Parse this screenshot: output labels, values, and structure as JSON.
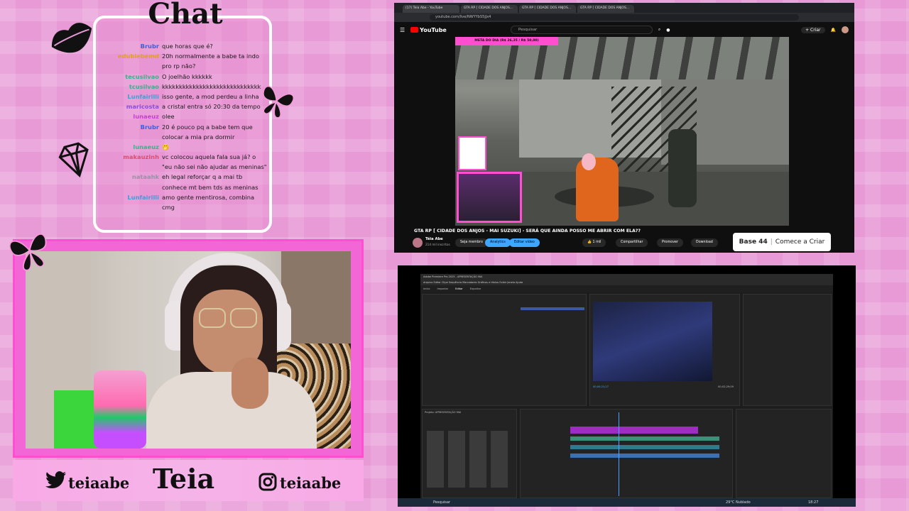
{
  "chat": {
    "title": "Chat",
    "messages": [
      {
        "user": "Brubr",
        "color": "#3f5fd8",
        "text": "que horas que é?"
      },
      {
        "user": "edubiebemd",
        "color": "#e2a11a",
        "text": "20h normalmente a babe ta indo"
      },
      {
        "user": "",
        "color": "#e2a11a",
        "text": "pro rp não?"
      },
      {
        "user": "tecusilvao",
        "color": "#37b38a",
        "text": "O joelhão kkkkkk"
      },
      {
        "user": "tcusilvao",
        "color": "#37b38a",
        "text": "kkkkkkkkkkkkkkkkkkkkkkkkkkkkk"
      },
      {
        "user": "Lunfairilli",
        "color": "#3f9fd8",
        "text": "isso gente, a mod perdeu a linha"
      },
      {
        "user": "maricosta",
        "color": "#8b4fd8",
        "text": "a cristal entra só 20:30 da tempo"
      },
      {
        "user": "lunaeuz",
        "color": "#c43fd0",
        "text": "olee"
      },
      {
        "user": "Brubr",
        "color": "#3f5fd8",
        "text": "20 é pouco pq a babe tem que"
      },
      {
        "user": "",
        "color": "#3f5fd8",
        "text": "colocar a mia pra dormir"
      },
      {
        "user": "lunaeuz",
        "color": "#37b38a",
        "text": "🤭"
      },
      {
        "user": "makauzinh",
        "color": "#d84f6f",
        "text": "vc colocou aquela fala sua já? o"
      },
      {
        "user": "",
        "color": "#d84f6f",
        "text": "\"eu não sei não ajudar as meninas\""
      },
      {
        "user": "nataahk",
        "color": "#9a8fa8",
        "text": "eh legal reforçar q a mai tb"
      },
      {
        "user": "",
        "color": "#9a8fa8",
        "text": "conhece mt bem tds as meninas"
      },
      {
        "user": "Lunfairilli",
        "color": "#3f9fd8",
        "text": "amo gente mentirosa, combina"
      },
      {
        "user": "",
        "color": "#3f9fd8",
        "text": "cmg"
      }
    ]
  },
  "branding": {
    "twitter": "teiaabe",
    "name": "Teia",
    "instagram": "teiaabe"
  },
  "youtube": {
    "tabs": [
      "(17) Teia Abe - YouTube",
      "GTA RP [ CIDADE DOS ANJOS...",
      "GTA RP [ CIDADE DOS ANJOS...",
      "GTA RP [ CIDADE DOS ANJOS..."
    ],
    "url": "youtube.com/live/NWYYbS5jJx4",
    "logo": "YouTube",
    "search_placeholder": "Pesquisar",
    "create_label": "+ Criar",
    "banner": "META DO DIA (R$ 26,25 / R$ 50,00)",
    "video_title": "GTA RP [ CIDADE DOS ANJOS - MAI SUZUKI] - SERÁ QUE AINDA POSSO ME ABRIR COM ELA??",
    "channel": "Téia Abe",
    "subscribers": "214 mil inscritos",
    "join": "Seja membro",
    "analytics": "Analytics",
    "edit_video": "Editar vídeo",
    "likes": "1 mil",
    "share": "Compartilhar",
    "promote": "Promover",
    "download": "Download",
    "ad": {
      "brand": "Base 44",
      "cta": "Comece a Criar"
    }
  },
  "premiere": {
    "title": "Adobe Premiere Pro 2025 - APRESENTAÇÃO MAI",
    "menu": "Arquivo  Editar  Clipe  Sequência  Marcadores  Gráficos e títulos  Exibir  Janela  Ajuda",
    "workspaces": [
      "Início",
      "Importar",
      "Editar",
      "Exportar"
    ],
    "timecode_left": "00;00;21;27",
    "timecode_right": "00;02;29;09",
    "project_name": "Projeto: APRESENTAÇÃO MAI",
    "taskbar_search": "Pesquisar",
    "weather": "29°C Nublado",
    "clock": "18:27"
  }
}
